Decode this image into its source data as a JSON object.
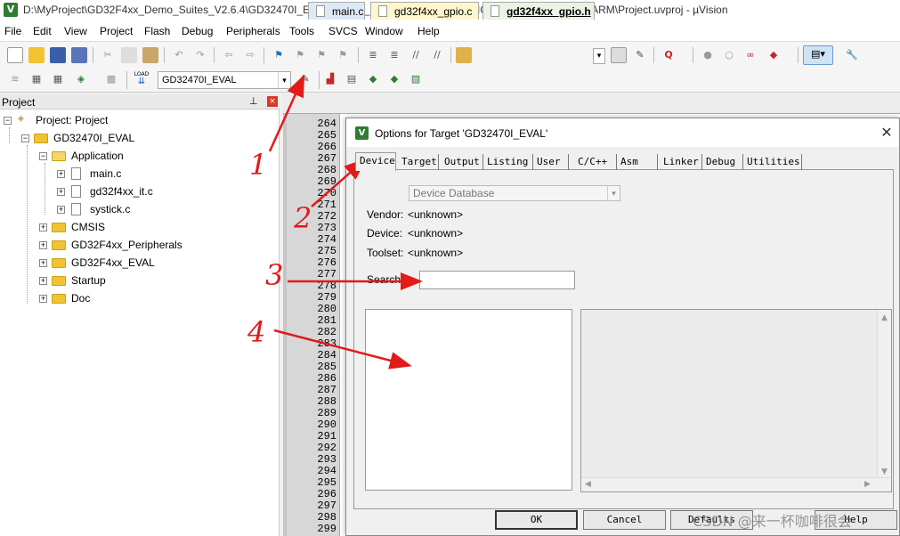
{
  "window": {
    "title": "D:\\MyProject\\GD32F4xx_Demo_Suites_V2.6.4\\GD32470I_EVAL_Demo_Suites\\Projects\\01_GPIO_Running_LED\\MDK-ARM\\Project.uvproj - µVision",
    "app_icon": "V"
  },
  "menu": [
    "File",
    "Edit",
    "View",
    "Project",
    "Flash",
    "Debug",
    "Peripherals",
    "Tools",
    "SVCS",
    "Window",
    "Help"
  ],
  "toolbar2": {
    "target_value": "GD32470I_EVAL",
    "load_label": "LOAD"
  },
  "project_panel": {
    "title": "Project",
    "root": "Project: Project",
    "target": "GD32470I_EVAL",
    "groups": [
      {
        "name": "Application",
        "files": [
          "main.c",
          "gd32f4xx_it.c",
          "systick.c"
        ]
      },
      {
        "name": "CMSIS"
      },
      {
        "name": "GD32F4xx_Peripherals"
      },
      {
        "name": "GD32F4xx_EVAL"
      },
      {
        "name": "Startup"
      },
      {
        "name": "Doc"
      }
    ]
  },
  "editor": {
    "tabs": [
      "main.c",
      "gd32f4xx_gpio.c",
      "gd32f4xx_gpio.h"
    ],
    "active_tab": "gd32f4xx_gpio.h",
    "line_numbers": [
      "264",
      "265",
      "266",
      "267",
      "268",
      "269",
      "270",
      "271",
      "272",
      "273",
      "274",
      "275",
      "276",
      "277",
      "278",
      "279",
      "280",
      "281",
      "282",
      "283",
      "284",
      "285",
      "286",
      "287",
      "288",
      "289",
      "290",
      "291",
      "292",
      "293",
      "294",
      "295",
      "296",
      "297",
      "298",
      "299"
    ]
  },
  "dialog": {
    "title": "Options for Target 'GD32470I_EVAL'",
    "tabs": [
      "Device",
      "Target",
      "Output",
      "Listing",
      "User",
      "C/C++",
      "Asm",
      "Linker",
      "Debug",
      "Utilities"
    ],
    "active_tab": "Device",
    "device_database": "Device Database",
    "vendor_label": "Vendor:",
    "vendor_value": "<unknown>",
    "device_label": "Device:",
    "device_value": "<unknown>",
    "toolset_label": "Toolset:",
    "toolset_value": "<unknown>",
    "search_label": "Search:",
    "search_value": "",
    "buttons": {
      "ok": "OK",
      "cancel": "Cancel",
      "defaults": "Defaults",
      "help": "Help"
    }
  },
  "annotations": {
    "numbers": [
      "1",
      "2",
      "3",
      "4"
    ],
    "color": "#e21a1a"
  },
  "watermark": "CSDN @来一杯咖啡很会"
}
